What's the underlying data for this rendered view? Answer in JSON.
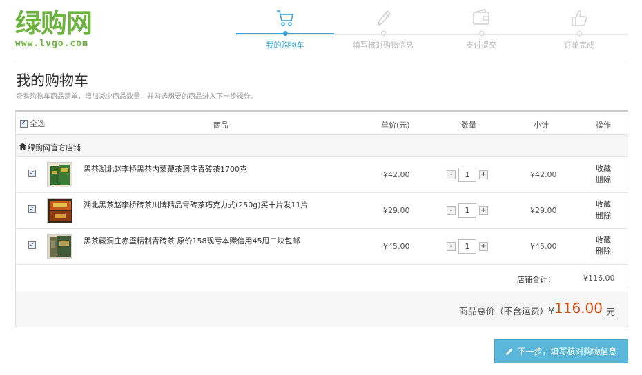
{
  "logo": {
    "text_cn": "绿购网",
    "url": "www.lvgo.com"
  },
  "steps": [
    {
      "label": "我的购物车",
      "icon": "cart-icon",
      "active": true
    },
    {
      "label": "填写核对购物信息",
      "icon": "pencil-icon",
      "active": false
    },
    {
      "label": "支付提交",
      "icon": "wallet-icon",
      "active": false
    },
    {
      "label": "订单完成",
      "icon": "thumbs-up-icon",
      "active": false
    }
  ],
  "page": {
    "title": "我的购物车",
    "subtitle": "查看购物车商品清单，增加减少商品数量，并勾选想要的商品进入下一步操作。"
  },
  "table": {
    "headers": {
      "select_all": "全选",
      "goods": "商品",
      "price": "单价(元)",
      "qty": "数量",
      "subtotal": "小计",
      "ops": "操作"
    },
    "shop_name": "绿购网官方店铺",
    "items": [
      {
        "name": "黑茶湖北赵李桥黑茶内蒙藏茶洞庄青砖茶1700克",
        "price": "¥42.00",
        "qty": "1",
        "subtotal": "¥42.00",
        "fav": "收藏",
        "del": "删除",
        "minus": "-",
        "plus": "+"
      },
      {
        "name": "湖北黑茶赵李桥砖茶川牌精品青砖茶巧克力式(250g)买十片发11片",
        "price": "¥29.00",
        "qty": "1",
        "subtotal": "¥29.00",
        "fav": "收藏",
        "del": "删除",
        "minus": "-",
        "plus": "+"
      },
      {
        "name": "黑茶藏洞庄赤壁精制青砖茶 原价158现亏本赚信用45甩二块包邮",
        "price": "¥45.00",
        "qty": "1",
        "subtotal": "¥45.00",
        "fav": "收藏",
        "del": "删除",
        "minus": "-",
        "plus": "+"
      }
    ],
    "shop_total_label": "店铺合计：",
    "shop_total_value": "¥116.00"
  },
  "grand": {
    "label": "商品总价（不含运费）¥",
    "amount": "116.00",
    "unit": "元"
  },
  "next_button": "下一步，填写核对购物信息",
  "colors": {
    "brand_green": "#6cb33f",
    "accent_blue": "#39a1d6",
    "price_red": "#d14b0b",
    "button_blue": "#5bb7d9"
  }
}
